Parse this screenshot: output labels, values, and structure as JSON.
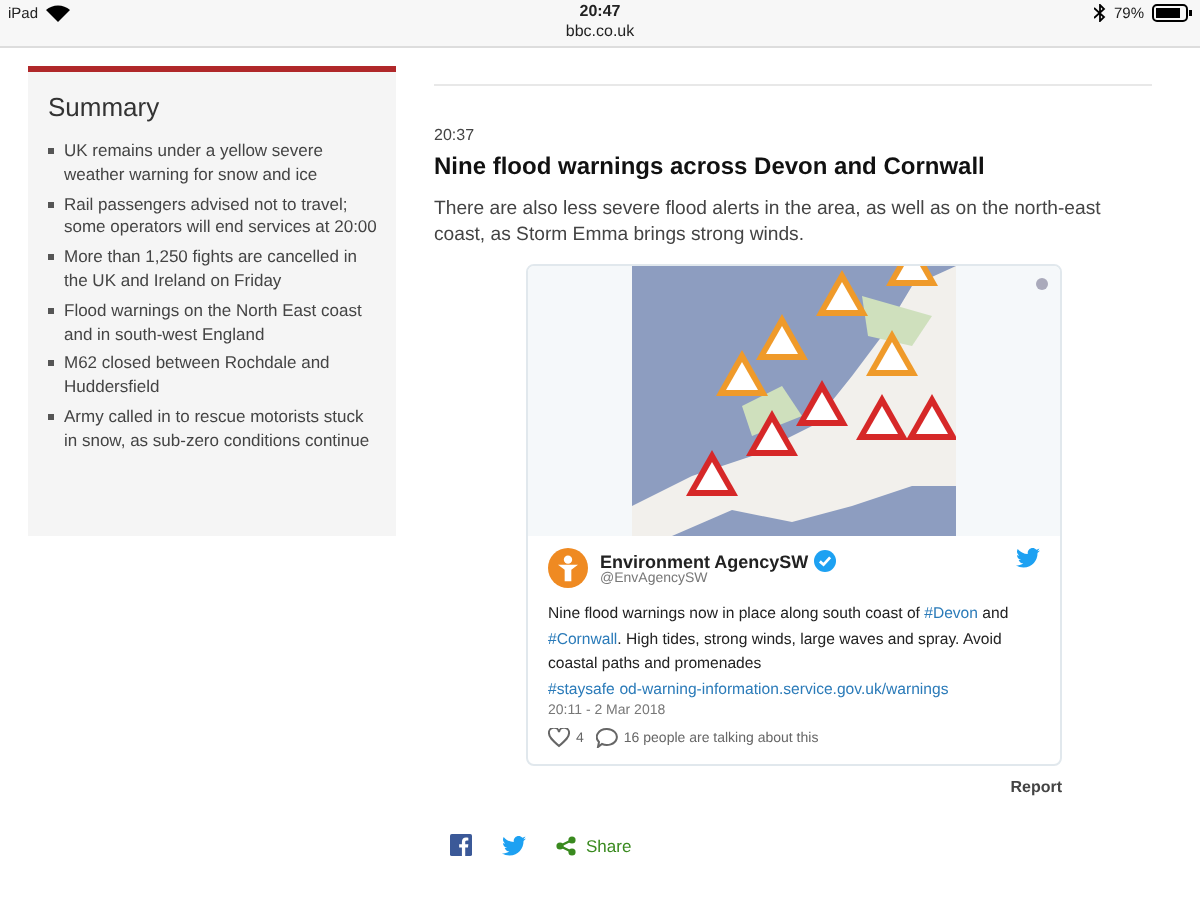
{
  "status_bar": {
    "device": "iPad",
    "time": "20:47",
    "url": "bbc.co.uk",
    "battery": "79%"
  },
  "summary": {
    "title": "Summary",
    "items": [
      "UK remains under a yellow severe weather warning for snow and ice",
      "Rail passengers advised not to travel; some operators will end services at 20:00",
      "More than 1,250 fights are cancelled in the UK and Ireland on Friday",
      "Flood warnings on the North East coast and in south-west England",
      "M62 closed between Rochdale and Huddersfield",
      "Army called in to rescue motorists stuck in snow, as sub-zero conditions continue"
    ]
  },
  "post": {
    "time": "20:37",
    "title": "Nine flood warnings across Devon and Cornwall",
    "body": "There are also less severe flood alerts in the area, as well as on the north-east coast, as Storm Emma brings strong winds.",
    "tweet": {
      "name": "Environment AgencySW",
      "verified": true,
      "handle": "@EnvAgencySW",
      "text": [
        {
          "kind": "text",
          "text": "Nine flood warnings now in place along south coast of "
        },
        {
          "kind": "link",
          "text": "#Devon"
        },
        {
          "kind": "text",
          "text": " and "
        },
        {
          "kind": "link",
          "text": "#Cornwall"
        },
        {
          "kind": "text",
          "text": ".  High tides, strong winds, large waves and spray. Avoid coastal paths and promenades "
        },
        {
          "kind": "link",
          "text": "#staysafe"
        },
        {
          "kind": "link",
          "text": "od-warning-information.service.gov.uk/warnings"
        }
      ],
      "date": "20:11 - 2 Mar 2018",
      "likes": "4",
      "talking": "16 people are talking about this"
    },
    "report": "Report",
    "share": "Share"
  }
}
